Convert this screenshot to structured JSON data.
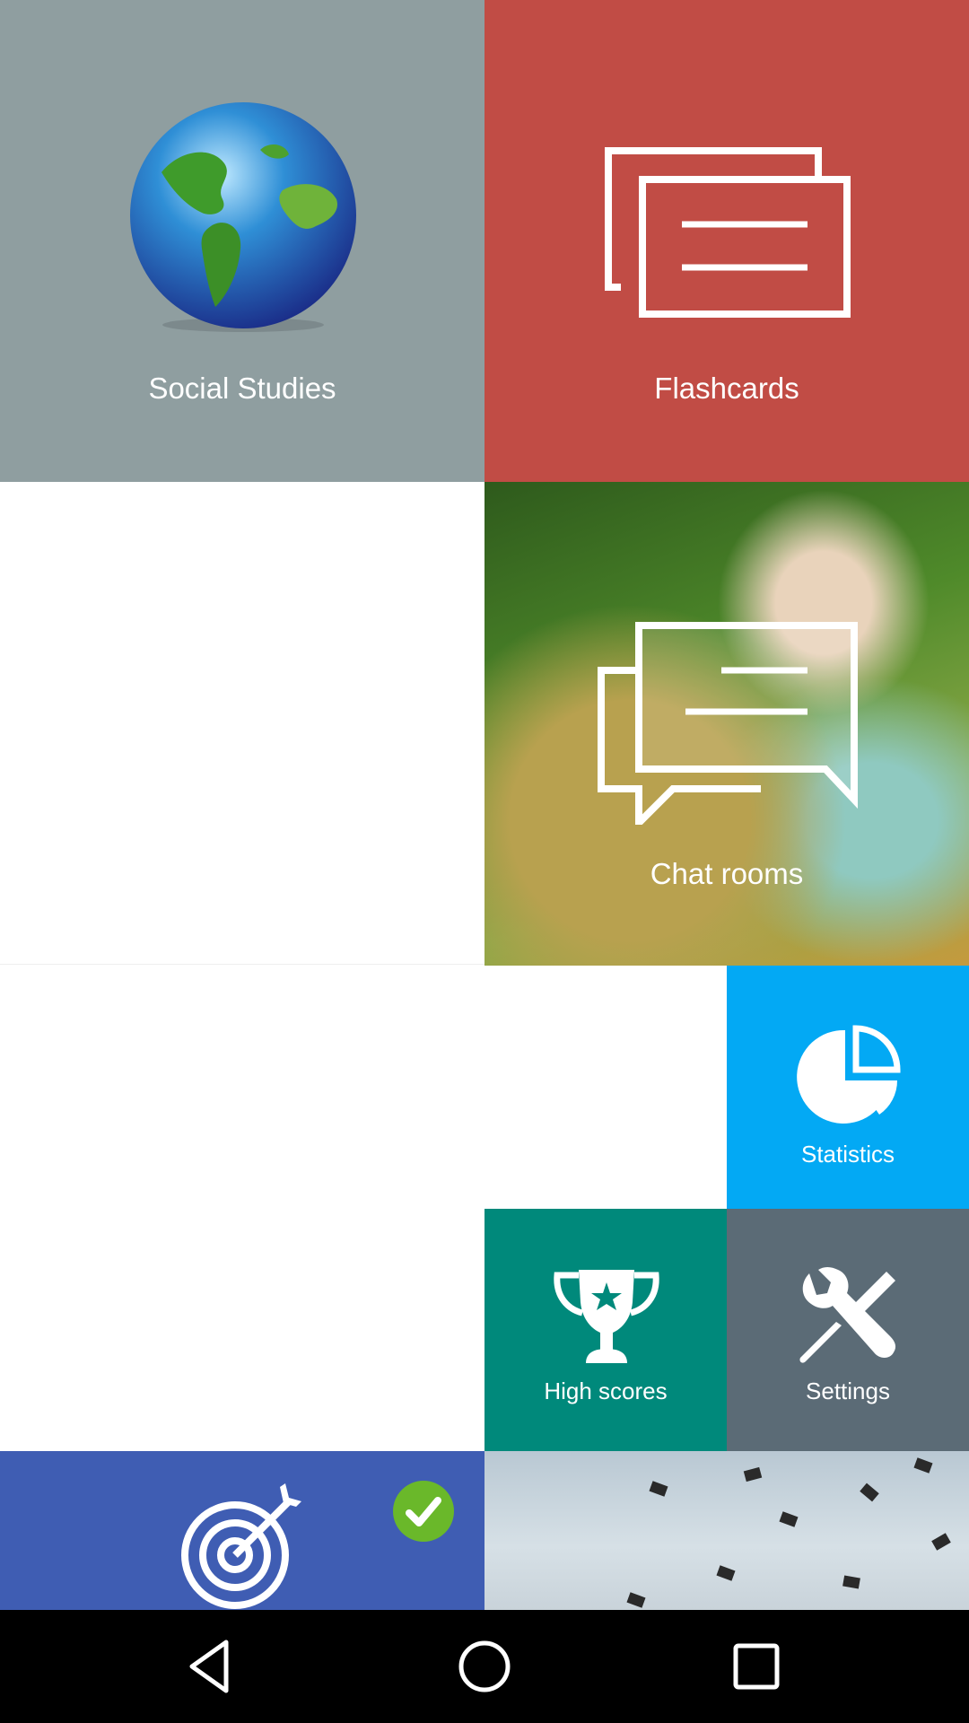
{
  "tiles": {
    "social_studies": {
      "label": "Social Studies",
      "icon": "globe-icon",
      "color": "#8f9ea0"
    },
    "flashcards": {
      "label": "Flashcards",
      "icon": "flashcards-icon",
      "color": "#c14c45"
    },
    "chat_rooms": {
      "label": "Chat rooms",
      "icon": "chat-bubbles-icon"
    },
    "statistics": {
      "label": "Statistics",
      "icon": "pie-chart-icon",
      "color": "#03a9f4"
    },
    "high_scores": {
      "label": "High scores",
      "icon": "trophy-icon",
      "color": "#00897b"
    },
    "settings": {
      "label": "Settings",
      "icon": "wrench-screwdriver-icon",
      "color": "#5b6b76"
    },
    "goals": {
      "icon": "target-icon",
      "badge_icon": "check-icon",
      "color": "#3f5db3",
      "badge_color": "#6ab82a"
    },
    "graduation": {
      "icon": "graduation-caps-image"
    }
  },
  "navbar": {
    "back_icon": "back-icon",
    "home_icon": "home-icon",
    "recents_icon": "recents-icon"
  }
}
